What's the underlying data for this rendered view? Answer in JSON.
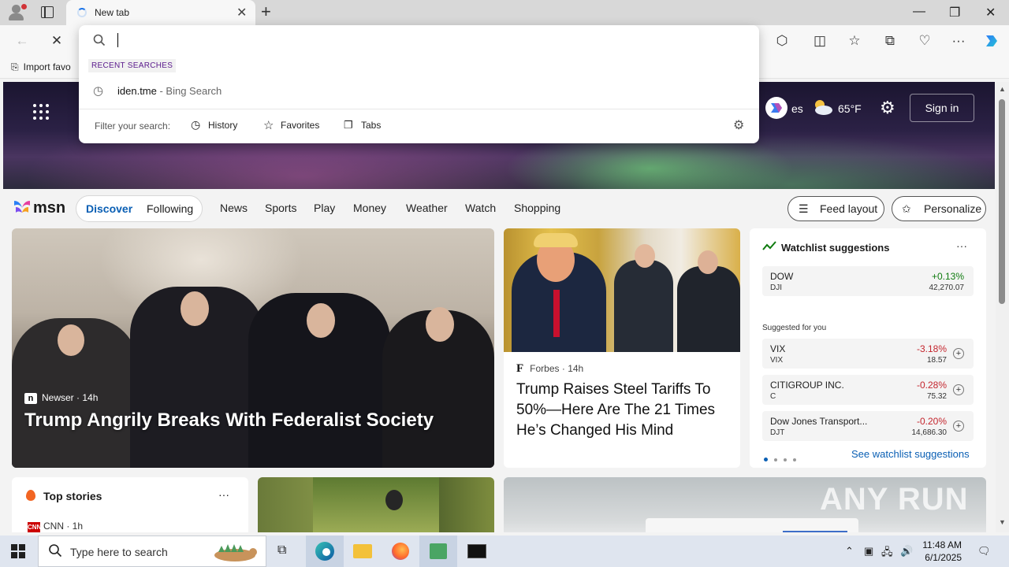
{
  "browser": {
    "tab_title": "New tab",
    "favorites_bar_item": "Import favo"
  },
  "omnibox": {
    "recent_label": "RECENT SEARCHES",
    "history_item": "iden.tme",
    "history_suffix": " - Bing Search",
    "filter_label": "Filter your search:",
    "filters": [
      "History",
      "Favorites",
      "Tabs"
    ]
  },
  "hero": {
    "weather_partial": "es",
    "temperature": "65°F",
    "signin": "Sign in"
  },
  "msn": {
    "logo": "msn",
    "pill_tabs": [
      "Discover",
      "Following"
    ],
    "nav": [
      "News",
      "Sports",
      "Play",
      "Money",
      "Weather",
      "Watch",
      "Shopping"
    ],
    "feed_layout": "Feed layout",
    "personalize": "Personalize"
  },
  "main_story": {
    "source": "Newser",
    "age": " · 14h",
    "headline": "Trump Angrily Breaks With Federalist Society"
  },
  "second_story": {
    "source": "Forbes",
    "age": " · 14h",
    "headline": "Trump Raises Steel Tariffs To 50%—Here Are The 21 Times He’s Changed His Mind"
  },
  "watchlist": {
    "title": "Watchlist suggestions",
    "more": "···",
    "featured": {
      "name": "DOW",
      "symbol": "DJI",
      "change": "+0.13%",
      "value": "42,270.07"
    },
    "suggested_label": "Suggested for you",
    "suggestions": [
      {
        "name": "VIX",
        "symbol": "VIX",
        "change": "-3.18%",
        "value": "18.57"
      },
      {
        "name": "CITIGROUP INC.",
        "symbol": "C",
        "change": "-0.28%",
        "value": "75.32"
      },
      {
        "name": "Dow Jones Transport...",
        "symbol": "DJT",
        "change": "-0.20%",
        "value": "14,686.30"
      }
    ],
    "see_all": "See watchlist suggestions"
  },
  "top_stories": {
    "title": "Top stories",
    "more": "···",
    "first_source": "CNN · 1h"
  },
  "taskbar": {
    "search_placeholder": "Type here to search",
    "time": "11:48 AM",
    "date": "6/1/2025"
  },
  "watermark": "ANY RUN",
  "colors": {
    "accent": "#0a5fb4",
    "positive": "#0f7b0f",
    "negative": "#c4262e"
  }
}
